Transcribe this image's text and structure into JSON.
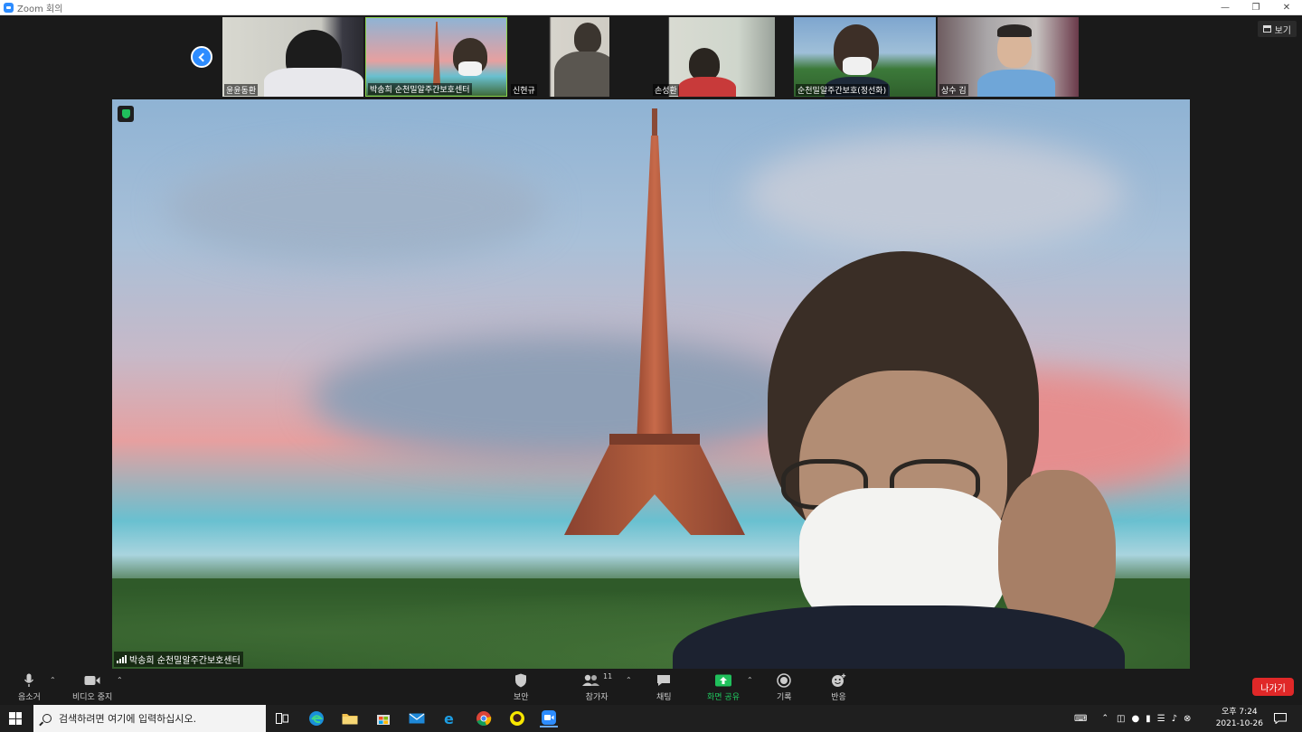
{
  "window": {
    "title": "Zoom 회의"
  },
  "header": {
    "view_label": "보기"
  },
  "thumbnails": [
    {
      "name": "윤윤동환"
    },
    {
      "name": "박송희 순천밀알주간보호센터"
    },
    {
      "name": "신현규"
    },
    {
      "name": "손성환"
    },
    {
      "name": "순천밀알주간보호(정선화)"
    },
    {
      "name": "상수 김"
    }
  ],
  "main_video": {
    "speaker_name": "박송희 순천밀알주간보호센터"
  },
  "toolbar": {
    "mute_label": "음소거",
    "video_label": "비디오 중지",
    "security_label": "보안",
    "participants_label": "참가자",
    "participants_count": "11",
    "chat_label": "채팅",
    "share_label": "화면 공유",
    "record_label": "기록",
    "reactions_label": "반응",
    "leave_label": "나가기"
  },
  "taskbar": {
    "search_placeholder": "검색하려면 여기에 입력하십시오.",
    "time": "오후 7:24",
    "date": "2021-10-26"
  },
  "colors": {
    "accent": "#2d8cff",
    "leave": "#e02828",
    "share": "#20c05c",
    "active_border": "#8bd44d"
  }
}
